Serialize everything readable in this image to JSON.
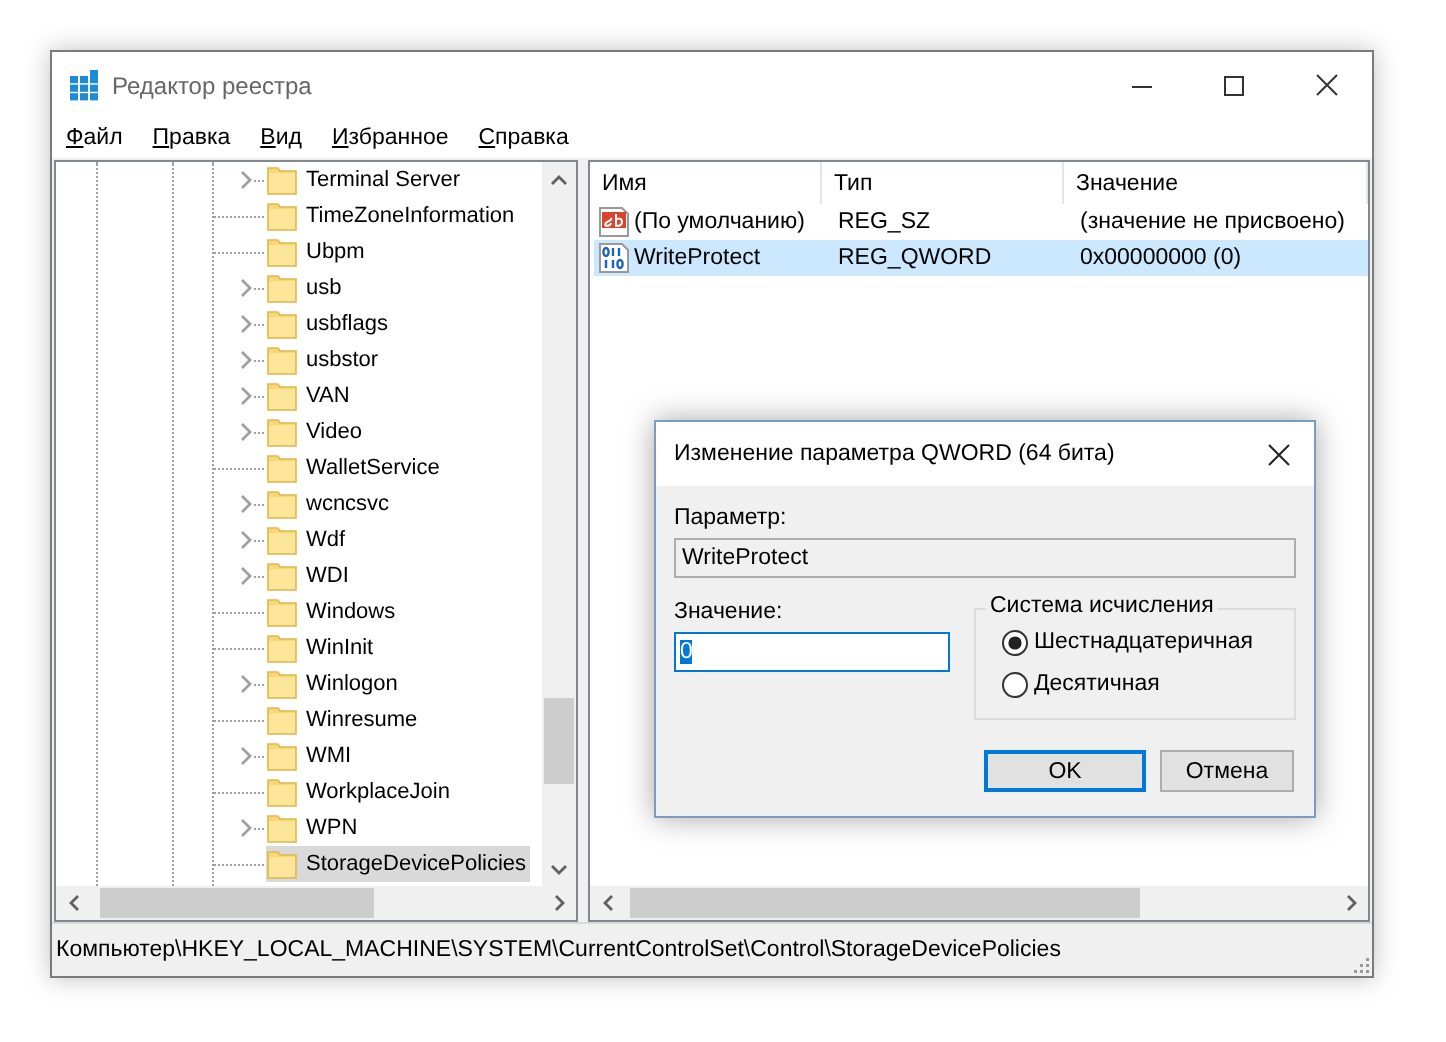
{
  "window": {
    "title": "Редактор реестра"
  },
  "menu": [
    "Файл",
    "Правка",
    "Вид",
    "Избранное",
    "Справка"
  ],
  "tree": {
    "items": [
      {
        "label": "Terminal Server",
        "expandable": true,
        "selected": false
      },
      {
        "label": "TimeZoneInformation",
        "expandable": false,
        "selected": false
      },
      {
        "label": "Ubpm",
        "expandable": false,
        "selected": false
      },
      {
        "label": "usb",
        "expandable": true,
        "selected": false
      },
      {
        "label": "usbflags",
        "expandable": true,
        "selected": false
      },
      {
        "label": "usbstor",
        "expandable": true,
        "selected": false
      },
      {
        "label": "VAN",
        "expandable": true,
        "selected": false
      },
      {
        "label": "Video",
        "expandable": true,
        "selected": false
      },
      {
        "label": "WalletService",
        "expandable": false,
        "selected": false
      },
      {
        "label": "wcncsvc",
        "expandable": true,
        "selected": false
      },
      {
        "label": "Wdf",
        "expandable": true,
        "selected": false
      },
      {
        "label": "WDI",
        "expandable": true,
        "selected": false
      },
      {
        "label": "Windows",
        "expandable": false,
        "selected": false
      },
      {
        "label": "WinInit",
        "expandable": false,
        "selected": false
      },
      {
        "label": "Winlogon",
        "expandable": true,
        "selected": false
      },
      {
        "label": "Winresume",
        "expandable": false,
        "selected": false
      },
      {
        "label": "WMI",
        "expandable": true,
        "selected": false
      },
      {
        "label": "WorkplaceJoin",
        "expandable": false,
        "selected": false
      },
      {
        "label": "WPN",
        "expandable": true,
        "selected": false
      },
      {
        "label": "StorageDevicePolicies",
        "expandable": false,
        "selected": true
      }
    ]
  },
  "values": {
    "columns": [
      "Имя",
      "Тип",
      "Значение"
    ],
    "rows": [
      {
        "kind": "string",
        "name": "(По умолчанию)",
        "type": "REG_SZ",
        "data": "(значение не присвоено)",
        "selected": false
      },
      {
        "kind": "binary",
        "name": "WriteProtect",
        "type": "REG_QWORD",
        "data": "0x00000000 (0)",
        "selected": true
      }
    ]
  },
  "dialog": {
    "title": "Изменение параметра QWORD (64 бита)",
    "param_label": "Параметр:",
    "param_value": "WriteProtect",
    "value_label": "Значение:",
    "value": "0",
    "value_selected": true,
    "radix": {
      "title": "Система исчисления",
      "options": [
        {
          "label": "Шестнадцатеричная",
          "selected": true
        },
        {
          "label": "Десятичная",
          "selected": false
        }
      ]
    },
    "buttons": [
      {
        "label": "OK",
        "default": true
      },
      {
        "label": "Отмена",
        "default": false
      }
    ]
  },
  "status_bar": "Компьютер\\HKEY_LOCAL_MACHINE\\SYSTEM\\CurrentControlSet\\Control\\StorageDevicePolicies"
}
